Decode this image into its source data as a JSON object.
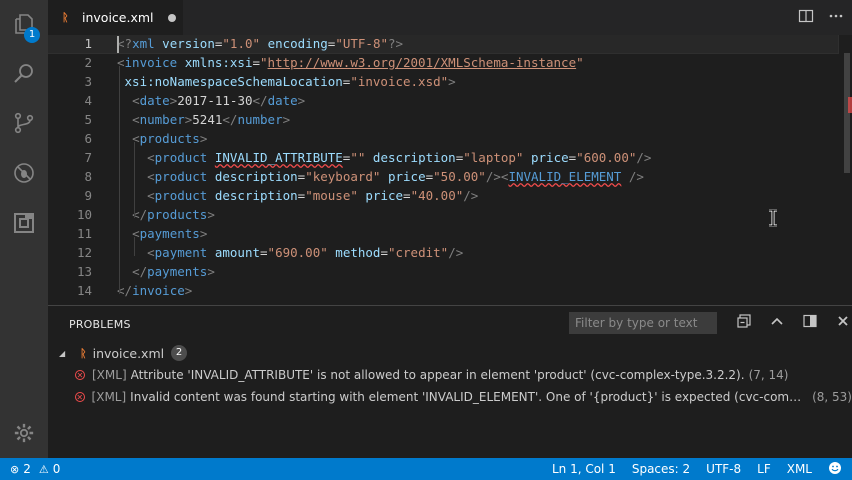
{
  "activity_bar": {
    "explorer_badge": "1"
  },
  "tab": {
    "icon_glyph": "ᚱ",
    "filename": "invoice.xml"
  },
  "editor": {
    "lines": [
      {
        "n": "1",
        "tokens": [
          [
            "punc",
            "<?"
          ],
          [
            "tag",
            "xml"
          ],
          [
            "t",
            " "
          ],
          [
            "attr",
            "version"
          ],
          [
            "t",
            "="
          ],
          [
            "str",
            "\"1.0\""
          ],
          [
            "t",
            " "
          ],
          [
            "attr",
            "encoding"
          ],
          [
            "t",
            "="
          ],
          [
            "str",
            "\"UTF-8\""
          ],
          [
            "punc",
            "?>"
          ]
        ]
      },
      {
        "n": "2",
        "tokens": [
          [
            "punc",
            "<"
          ],
          [
            "tag",
            "invoice"
          ],
          [
            "t",
            " "
          ],
          [
            "attr",
            "xmlns:xsi"
          ],
          [
            "t",
            "="
          ],
          [
            "str",
            "\""
          ],
          [
            "link",
            "http://www.w3.org/2001/XMLSchema-instance"
          ],
          [
            "str",
            "\""
          ]
        ]
      },
      {
        "n": "3",
        "tokens": [
          [
            "t",
            " "
          ],
          [
            "attr",
            "xsi:noNamespaceSchemaLocation"
          ],
          [
            "t",
            "="
          ],
          [
            "str",
            "\"invoice.xsd\""
          ],
          [
            "punc",
            ">"
          ]
        ]
      },
      {
        "n": "4",
        "tokens": [
          [
            "t",
            "  "
          ],
          [
            "punc",
            "<"
          ],
          [
            "tag",
            "date"
          ],
          [
            "punc",
            ">"
          ],
          [
            "t",
            "2017-11-30"
          ],
          [
            "punc",
            "</"
          ],
          [
            "tag",
            "date"
          ],
          [
            "punc",
            ">"
          ]
        ]
      },
      {
        "n": "5",
        "tokens": [
          [
            "t",
            "  "
          ],
          [
            "punc",
            "<"
          ],
          [
            "tag",
            "number"
          ],
          [
            "punc",
            ">"
          ],
          [
            "t",
            "5241"
          ],
          [
            "punc",
            "</"
          ],
          [
            "tag",
            "number"
          ],
          [
            "punc",
            ">"
          ]
        ]
      },
      {
        "n": "6",
        "tokens": [
          [
            "t",
            "  "
          ],
          [
            "punc",
            "<"
          ],
          [
            "tag",
            "products"
          ],
          [
            "punc",
            ">"
          ]
        ]
      },
      {
        "n": "7",
        "tokens": [
          [
            "t",
            "    "
          ],
          [
            "punc",
            "<"
          ],
          [
            "tag",
            "product"
          ],
          [
            "t",
            " "
          ],
          [
            "attr_err",
            "INVALID_ATTRIBUTE"
          ],
          [
            "t",
            "="
          ],
          [
            "str",
            "\"\""
          ],
          [
            "t",
            " "
          ],
          [
            "attr",
            "description"
          ],
          [
            "t",
            "="
          ],
          [
            "str",
            "\"laptop\""
          ],
          [
            "t",
            " "
          ],
          [
            "attr",
            "price"
          ],
          [
            "t",
            "="
          ],
          [
            "str",
            "\"600.00\""
          ],
          [
            "punc",
            "/>"
          ]
        ]
      },
      {
        "n": "8",
        "tokens": [
          [
            "t",
            "    "
          ],
          [
            "punc",
            "<"
          ],
          [
            "tag",
            "product"
          ],
          [
            "t",
            " "
          ],
          [
            "attr",
            "description"
          ],
          [
            "t",
            "="
          ],
          [
            "str",
            "\"keyboard\""
          ],
          [
            "t",
            " "
          ],
          [
            "attr",
            "price"
          ],
          [
            "t",
            "="
          ],
          [
            "str",
            "\"50.00\""
          ],
          [
            "punc",
            "/>"
          ],
          [
            "punc",
            "<"
          ],
          [
            "tag_err",
            "INVALID_ELEMENT"
          ],
          [
            "t",
            " "
          ],
          [
            "punc",
            "/>"
          ]
        ]
      },
      {
        "n": "9",
        "tokens": [
          [
            "t",
            "    "
          ],
          [
            "punc",
            "<"
          ],
          [
            "tag",
            "product"
          ],
          [
            "t",
            " "
          ],
          [
            "attr",
            "description"
          ],
          [
            "t",
            "="
          ],
          [
            "str",
            "\"mouse\""
          ],
          [
            "t",
            " "
          ],
          [
            "attr",
            "price"
          ],
          [
            "t",
            "="
          ],
          [
            "str",
            "\"40.00\""
          ],
          [
            "punc",
            "/>"
          ]
        ]
      },
      {
        "n": "10",
        "tokens": [
          [
            "t",
            "  "
          ],
          [
            "punc",
            "</"
          ],
          [
            "tag",
            "products"
          ],
          [
            "punc",
            ">"
          ]
        ]
      },
      {
        "n": "11",
        "tokens": [
          [
            "t",
            "  "
          ],
          [
            "punc",
            "<"
          ],
          [
            "tag",
            "payments"
          ],
          [
            "punc",
            ">"
          ]
        ]
      },
      {
        "n": "12",
        "tokens": [
          [
            "t",
            "    "
          ],
          [
            "punc",
            "<"
          ],
          [
            "tag",
            "payment"
          ],
          [
            "t",
            " "
          ],
          [
            "attr",
            "amount"
          ],
          [
            "t",
            "="
          ],
          [
            "str",
            "\"690.00\""
          ],
          [
            "t",
            " "
          ],
          [
            "attr",
            "method"
          ],
          [
            "t",
            "="
          ],
          [
            "str",
            "\"credit\""
          ],
          [
            "punc",
            "/>"
          ]
        ]
      },
      {
        "n": "13",
        "tokens": [
          [
            "t",
            "  "
          ],
          [
            "punc",
            "</"
          ],
          [
            "tag",
            "payments"
          ],
          [
            "punc",
            ">"
          ]
        ]
      },
      {
        "n": "14",
        "tokens": [
          [
            "punc",
            "</"
          ],
          [
            "tag",
            "invoice"
          ],
          [
            "punc",
            ">"
          ]
        ]
      }
    ]
  },
  "panel": {
    "title": "PROBLEMS",
    "filter_placeholder": "Filter by type or text",
    "file": {
      "name": "invoice.xml",
      "count": "2"
    },
    "problems": [
      {
        "source": "[XML]",
        "message": "Attribute 'INVALID_ATTRIBUTE' is not allowed to appear in element 'product' (cvc-complex-type.3.2.2).",
        "location": "(7, 14)"
      },
      {
        "source": "[XML]",
        "message": "Invalid content was found starting with element 'INVALID_ELEMENT'. One of '{product}' is expected (cvc-complex-typ...",
        "location": "(8, 53)"
      }
    ]
  },
  "statusbar": {
    "errors": "2",
    "warnings": "0",
    "position": "Ln 1, Col 1",
    "spaces": "Spaces: 2",
    "encoding": "UTF-8",
    "eol": "LF",
    "language": "XML"
  },
  "colors": {
    "accent": "#007acc",
    "error": "#f14c4c",
    "xml_icon": "#e37933"
  }
}
